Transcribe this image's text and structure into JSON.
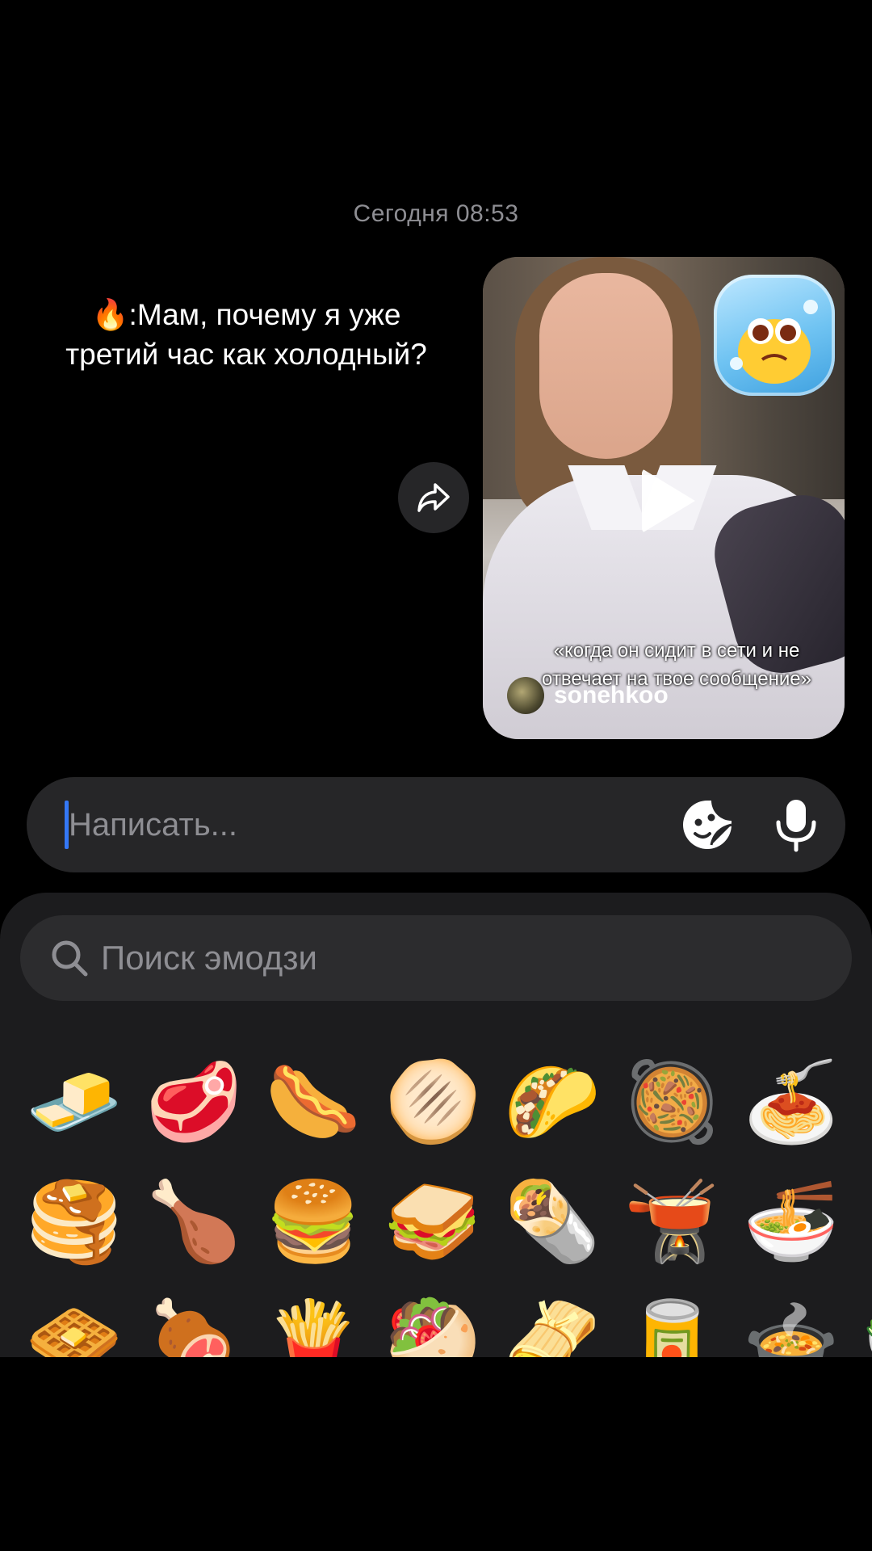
{
  "conversation": {
    "timestamp": "Сегодня 08:53",
    "overlay_caption": "🔥:Мам, почему я уже третий час как холодный?"
  },
  "video_message": {
    "caption": "«когда он сидит в сети и не отвечает на твое сообщение»",
    "author": "sonehkoo",
    "icons": {
      "play": "play-icon",
      "share": "share-arrow-icon",
      "sticker": "cold-face-sticker"
    }
  },
  "composer": {
    "placeholder": "Написать...",
    "sticker_icon": "sticker-icon",
    "mic_icon": "microphone-icon"
  },
  "emoji_panel": {
    "search_placeholder": "Поиск эмодзи",
    "rows": [
      [
        "🧈",
        "🥩",
        "🌭",
        "🫓",
        "🌮",
        "🥘",
        "🍝",
        "🥚"
      ],
      [
        "🥞",
        "🍗",
        "🍔",
        "🥪",
        "🌯",
        "🫕",
        "🍜",
        "🧂"
      ],
      [
        "🧇",
        "🍖",
        "🍟",
        "🥙",
        "🫔",
        "🥫",
        "🍲",
        "🥗"
      ]
    ]
  },
  "colors": {
    "background": "#000000",
    "bubble": "#262628",
    "panel": "#1c1c1e",
    "cursor": "#3478f6",
    "muted_text": "#8e8e93"
  }
}
